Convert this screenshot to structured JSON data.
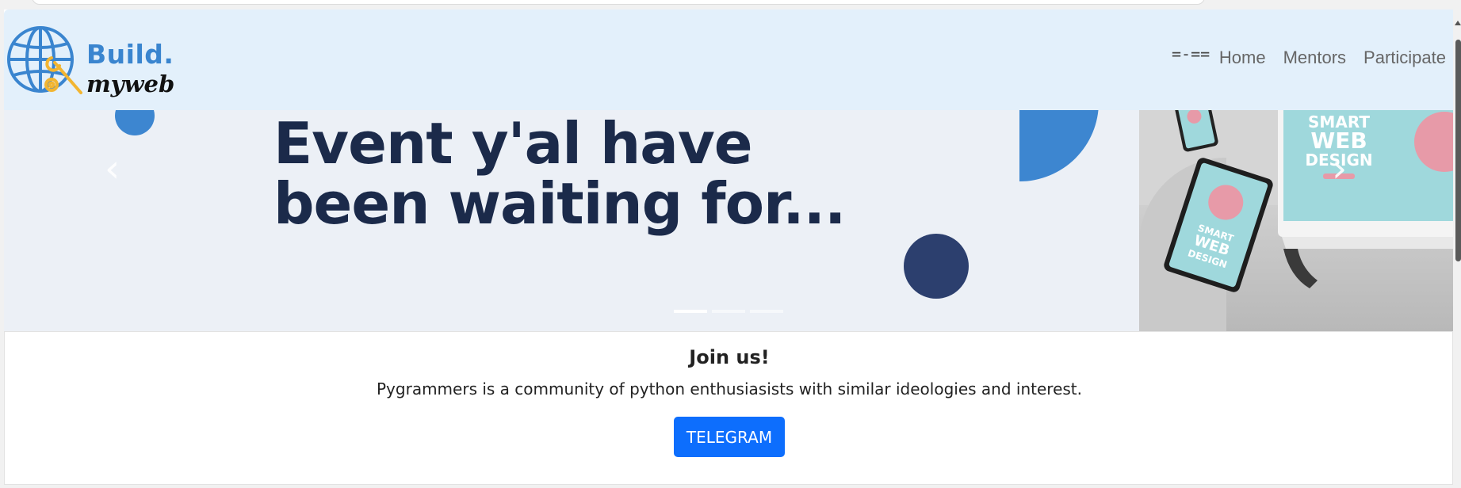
{
  "navbar": {
    "brand_line1": "Build.",
    "brand_line2": "myweb",
    "toggle_label": "=-==",
    "links": [
      "Home",
      "Mentors",
      "Participate"
    ]
  },
  "carousel": {
    "headline_line1": "Event y'al have",
    "headline_line2": "been waiting for...",
    "prev_icon": "chevron-left-icon",
    "next_icon": "chevron-right-icon",
    "slide_count": 3,
    "active_slide": 1,
    "device_labels": [
      "SMART",
      "WEB",
      "DESIGN"
    ]
  },
  "join": {
    "title": "Join us!",
    "description": "Pygrammers is a community of python enthusiasists with similar ideologies and interest.",
    "button_label": "TELEGRAM"
  },
  "colors": {
    "brand_blue": "#3a85cf",
    "navbar_bg": "#e3f0fb",
    "headline": "#1b2a4a",
    "button": "#0d6efd",
    "navy_dot": "#2c3f6e"
  }
}
